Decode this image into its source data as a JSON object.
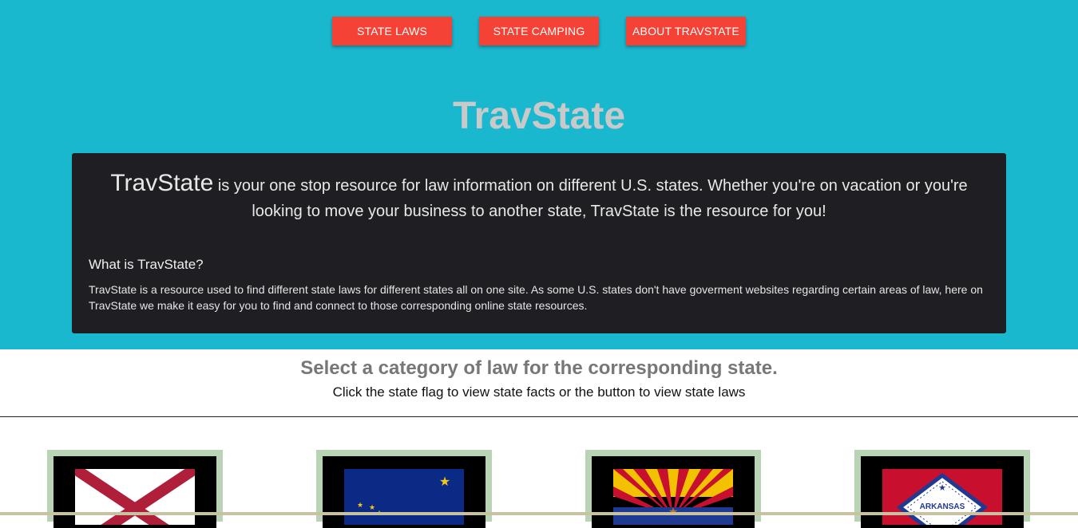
{
  "nav": {
    "laws_label": "STATE LAWS",
    "camping_label": "STATE CAMPING",
    "about_label": "ABOUT TRAVSTATE"
  },
  "hero": {
    "title": "TravState"
  },
  "intro": {
    "brand": "TravState",
    "lead": " is your one stop resource for law information on different U.S. states. Whether you're on vacation or you're looking to move your business to another state, TravState is the resource for you!",
    "heading": "What is TravState?",
    "body": "TravState is a resource used to find different state laws for different states all on one site. As some U.S. states don't have goverment websites regarding certain areas of law, here on TravState we make it easy for you to find and connect to those corresponding online state resources."
  },
  "select": {
    "heading": "Select a category of law for the corresponding state.",
    "subheading": "Click the state flag to view state facts or the button to view state laws"
  },
  "flags": [
    {
      "state": "alabama-flag"
    },
    {
      "state": "alaska-flag"
    },
    {
      "state": "arizona-flag"
    },
    {
      "state": "arkansas-flag",
      "label": "ARKANSAS"
    }
  ],
  "colors": {
    "hero_bg": "#1ab8cf",
    "button_red": "#f44336",
    "card_dark": "#1f1f23",
    "flag_frame": "#b9d3b5"
  }
}
